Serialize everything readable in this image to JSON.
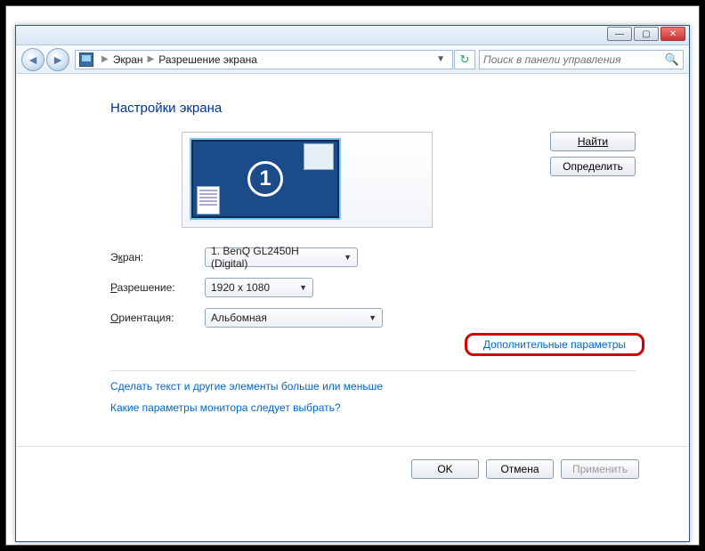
{
  "breadcrumb": {
    "item1": "Экран",
    "item2": "Разрешение экрана"
  },
  "search": {
    "placeholder": "Поиск в панели управления"
  },
  "heading": "Настройки экрана",
  "monitor_number": "1",
  "buttons": {
    "find": "Найти",
    "identify": "Определить",
    "ok": "OK",
    "cancel": "Отмена",
    "apply": "Применить"
  },
  "fields": {
    "display": {
      "label_pre": "Э",
      "label_u": "к",
      "label_post": "ран:",
      "value": "1. BenQ GL2450H (Digital)"
    },
    "resolution": {
      "label_u": "Р",
      "label_post": "азрешение:",
      "value": "1920 x 1080"
    },
    "orientation": {
      "label_u": "О",
      "label_post": "риентация:",
      "value": "Альбомная"
    }
  },
  "advanced_link": "Дополнительные параметры",
  "links": {
    "text_size": "Сделать текст и другие элементы больше или меньше",
    "which_settings": "Какие параметры монитора следует выбрать?"
  }
}
